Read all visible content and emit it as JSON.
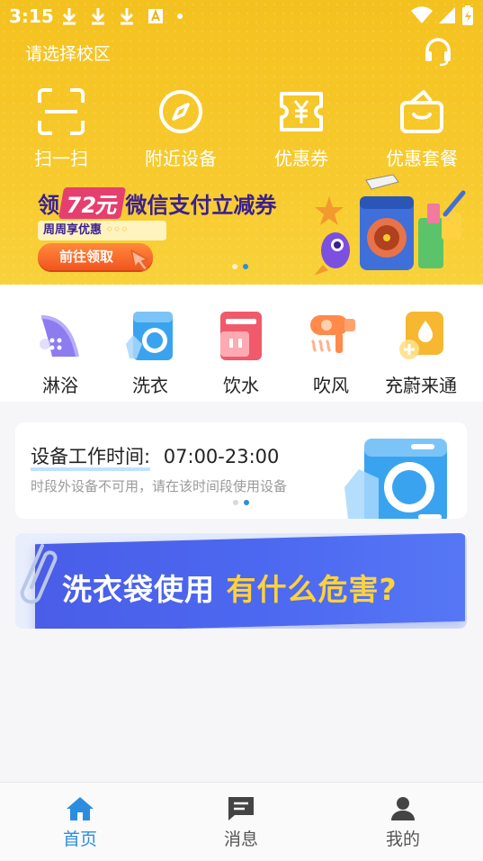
{
  "status_bar": {
    "time": "3:15",
    "notification_icons": [
      "download-icon",
      "download-icon",
      "download-icon",
      "a-icon",
      "dot-icon"
    ],
    "system_icons": [
      "wifi-icon",
      "signal-icon",
      "battery-icon"
    ]
  },
  "header": {
    "campus_select": "请选择校区",
    "support_icon": "headset-icon",
    "quick_actions": [
      {
        "label": "扫一扫",
        "icon": "scan-icon"
      },
      {
        "label": "附近设备",
        "icon": "compass-icon"
      },
      {
        "label": "优惠券",
        "icon": "coupon-icon"
      },
      {
        "label": "优惠套餐",
        "icon": "package-icon"
      }
    ]
  },
  "promo_banner": {
    "prefix": "领",
    "amount": "72元",
    "suffix": "微信支付立减券",
    "sub": "周周享优惠",
    "button": "前往领取",
    "slide_count": 2,
    "active_slide": 2
  },
  "services": [
    {
      "label": "淋浴",
      "icon": "shower-icon",
      "color": "#8c7cf0"
    },
    {
      "label": "洗衣",
      "icon": "washing-machine-icon",
      "color": "#3aa3f0"
    },
    {
      "label": "饮水",
      "icon": "water-dispenser-icon",
      "color": "#f05a6a"
    },
    {
      "label": "吹风",
      "icon": "hair-dryer-icon",
      "color": "#ff8a4a"
    },
    {
      "label": "充蔚来通",
      "icon": "charge-icon",
      "color": "#f7b731"
    }
  ],
  "work_time_card": {
    "title_label": "设备工作时间:",
    "hours": "07:00-23:00",
    "description": "时段外设备不可用，请在该时间段使用设备",
    "slide_count": 2,
    "active_slide": 2
  },
  "article_banner": {
    "text_white": "洗衣袋使用",
    "text_yellow": "有什么危害?"
  },
  "bottom_nav": [
    {
      "label": "首页",
      "icon": "home-icon",
      "active": true
    },
    {
      "label": "消息",
      "icon": "message-icon",
      "active": false
    },
    {
      "label": "我的",
      "icon": "profile-icon",
      "active": false
    }
  ],
  "colors": {
    "header_yellow": "#f7c92c",
    "accent_blue": "#2a8de0",
    "promo_purple": "#3a1f8f",
    "article_blue": "#4d6af1",
    "article_yellow": "#ffd23b"
  }
}
